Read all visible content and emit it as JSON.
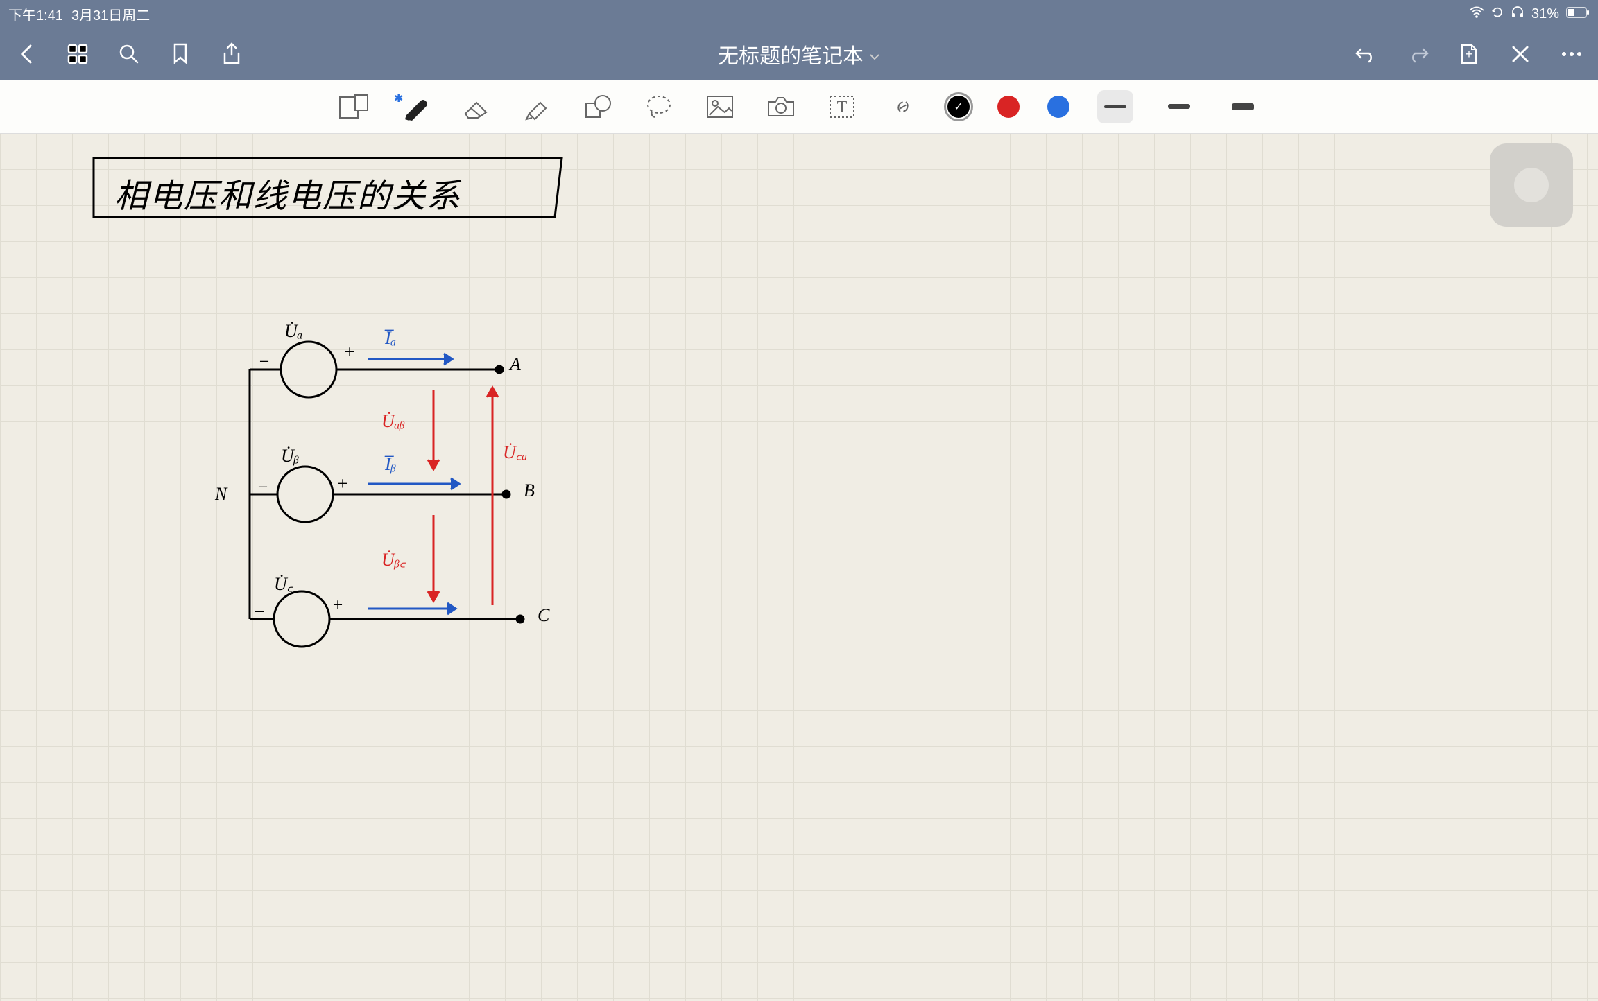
{
  "status": {
    "time": "下午1:41",
    "date": "3月31日周二",
    "wifi": "wifi-icon",
    "rotation": "rotation-lock-icon",
    "headphone": "headphone-icon",
    "battery_pct": "31%",
    "battery_icon": "battery-icon"
  },
  "header": {
    "title": "无标题的笔记本",
    "dropdown": "chevron-down-icon"
  },
  "tools": {
    "view_mode": "view-split-icon",
    "pen": "pen-icon",
    "eraser": "eraser-icon",
    "highlighter": "highlighter-icon",
    "shapes": "shapes-icon",
    "lasso": "lasso-icon",
    "image": "image-icon",
    "camera": "camera-icon",
    "text": "text-icon",
    "link": "link-icon"
  },
  "colors": {
    "black": "#000000",
    "red": "#d92424",
    "blue": "#2970e0",
    "selected": "black"
  },
  "strokes": {
    "thin": 4,
    "medium": 7,
    "thick": 10,
    "selected": "thin"
  },
  "handwriting": {
    "title_box": "相电压和线电压的关系",
    "labels": {
      "ua_top": "U̇ₐ",
      "ub_mid": "U̇ᵦ",
      "uc_bot": "U̇꜀",
      "ia": "I̅ₐ",
      "ib": "I̅ᵦ",
      "node_n": "N",
      "node_a": "A",
      "node_b": "B",
      "node_c": "C",
      "uab": "U̇ₐᵦ",
      "ubc": "U̇ᵦ꜀",
      "uca": "U̇꜀ₐ",
      "minus": "−",
      "plus": "+"
    }
  }
}
